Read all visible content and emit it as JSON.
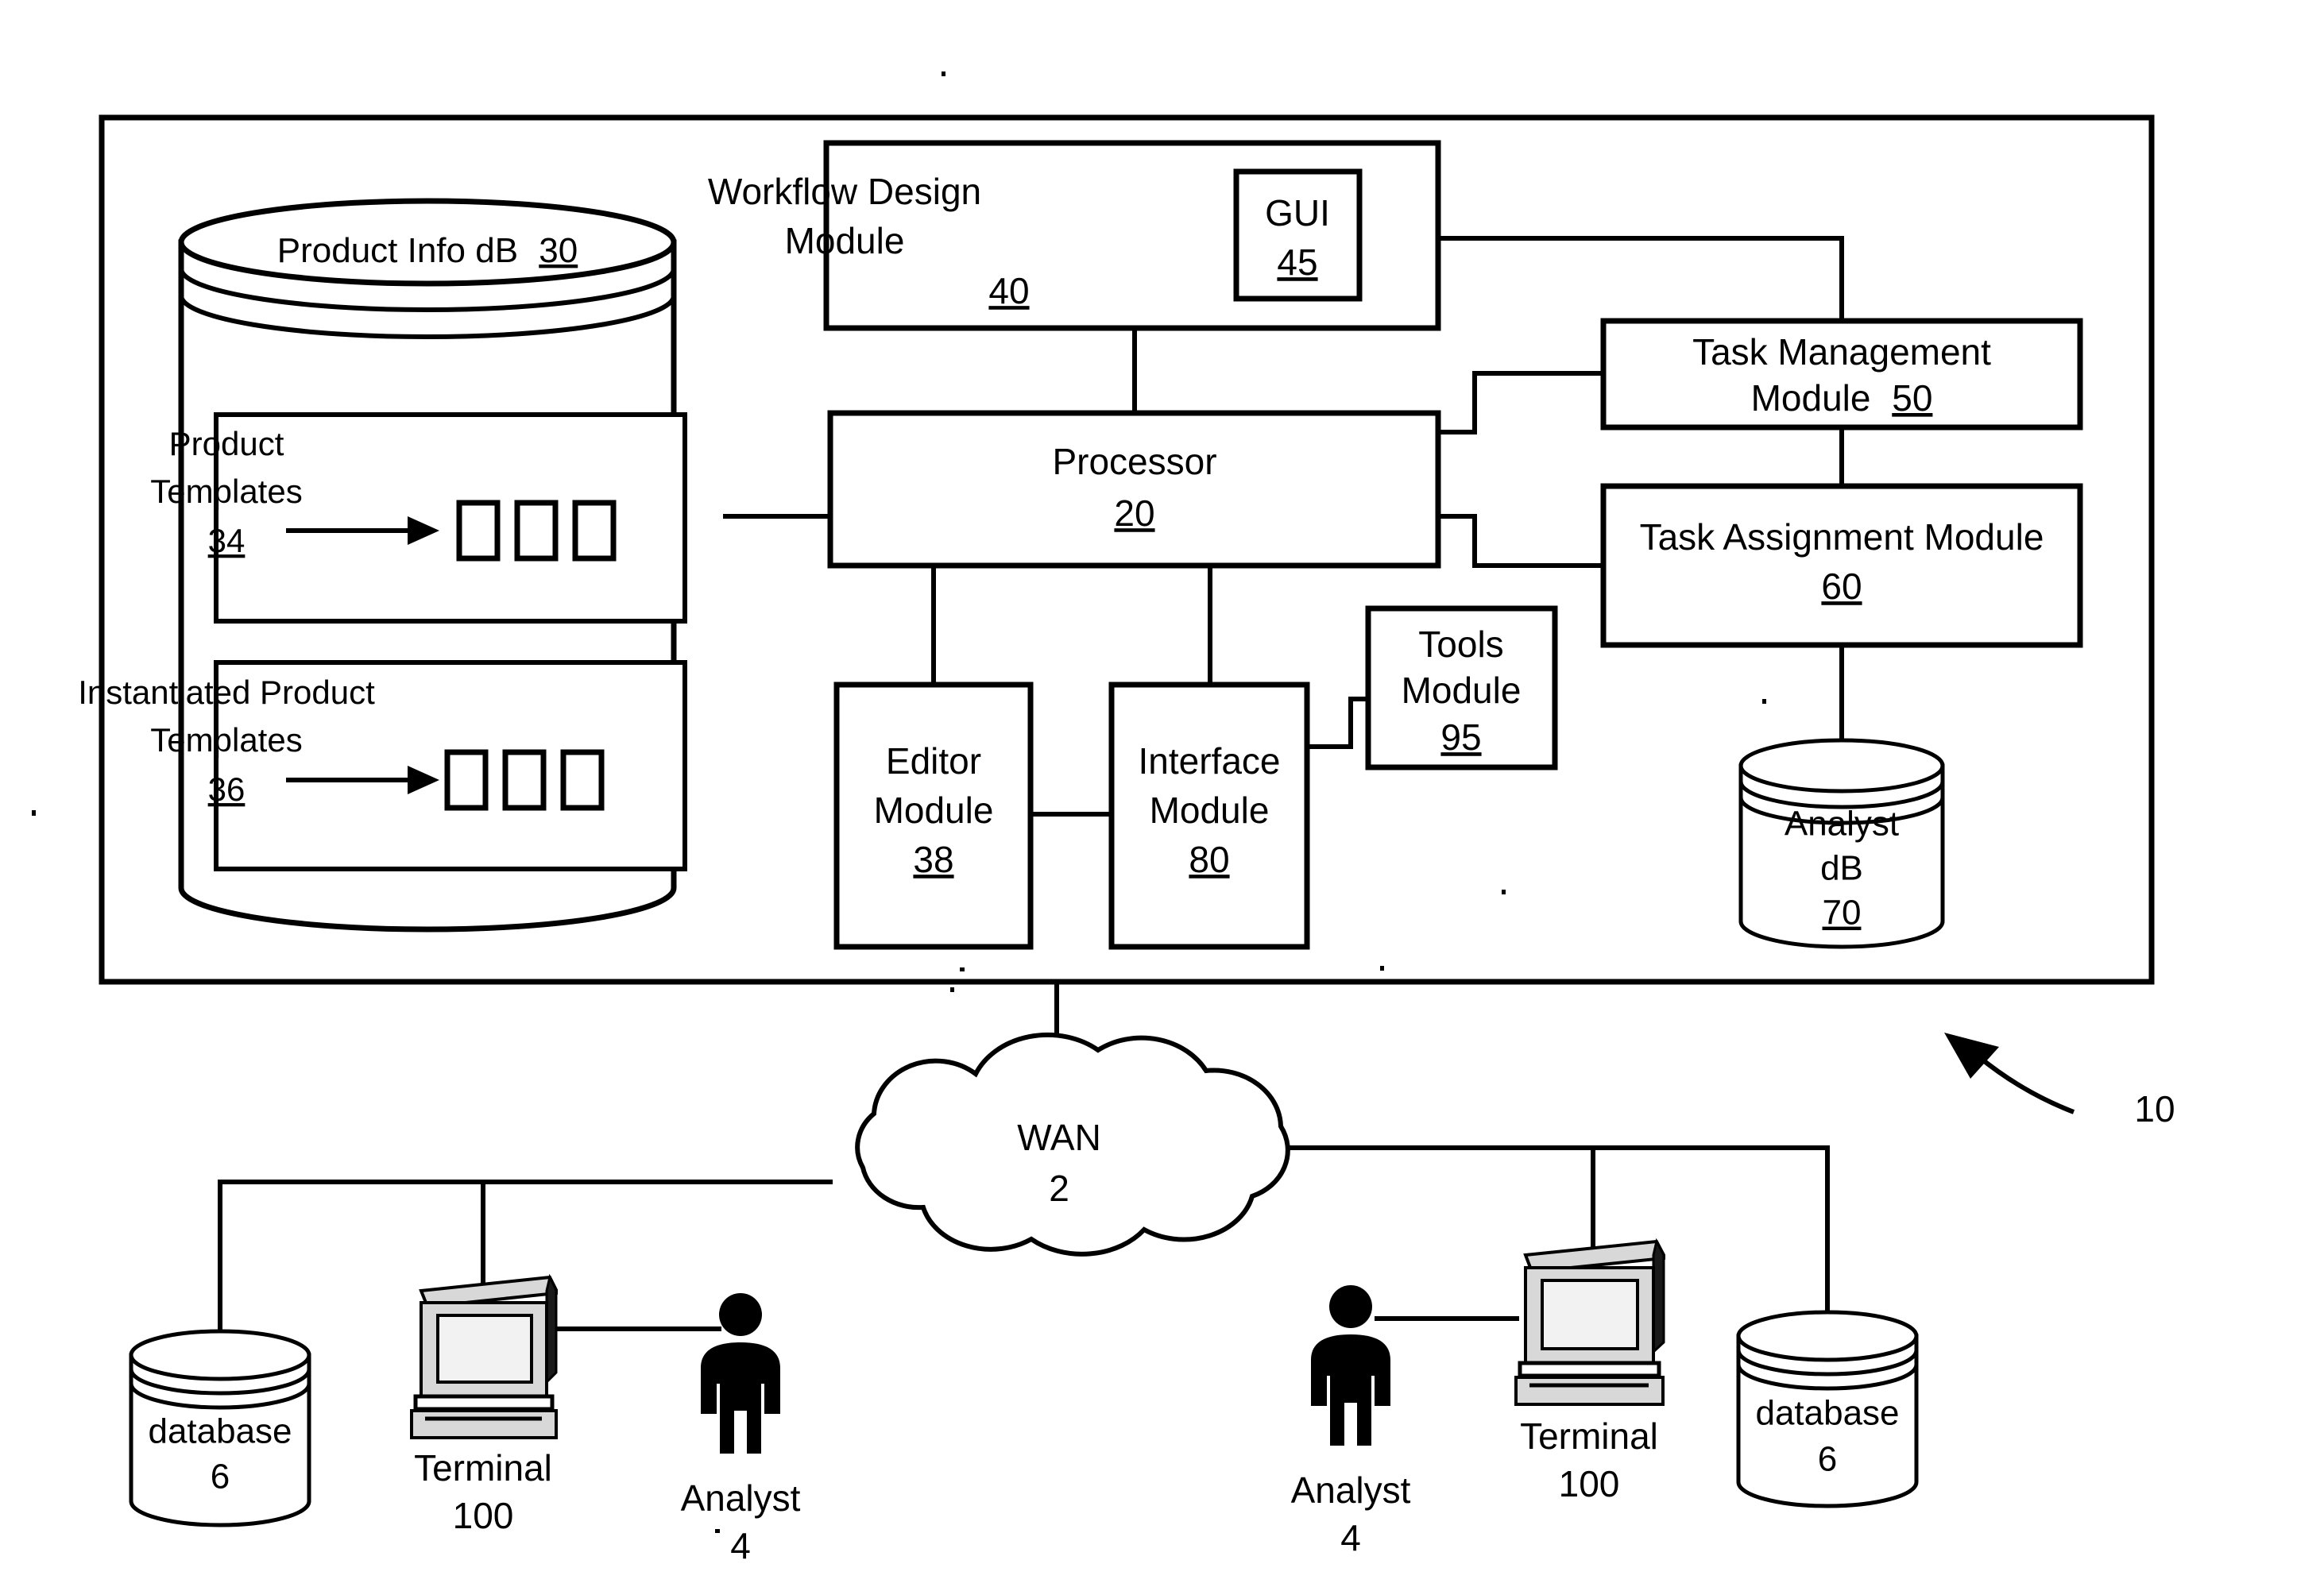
{
  "figure": {
    "reference_numeral": "10",
    "system_box": {
      "name": "system-enclosure"
    },
    "product_info_db": {
      "label": "Product Info dB",
      "numeral": "30",
      "inner_boxes": [
        {
          "label_line1": "Product",
          "label_line2": "Templates",
          "numeral": "34",
          "item_count": 3
        },
        {
          "label_line1": "Instantiated Product",
          "label_line2": "Templates",
          "numeral": "36",
          "item_count": 3
        }
      ]
    },
    "workflow_design_module": {
      "label_line1": "Workflow Design",
      "label_line2": "Module",
      "numeral": "40",
      "gui": {
        "label": "GUI",
        "numeral": "45"
      }
    },
    "processor": {
      "label": "Processor",
      "numeral": "20"
    },
    "task_management_module": {
      "label_line1": "Task Management",
      "label_line2": "Module",
      "numeral": "50"
    },
    "task_assignment_module": {
      "label_line1": "Task Assignment Module",
      "numeral": "60"
    },
    "tools_module": {
      "label_line1": "Tools",
      "label_line2": "Module",
      "numeral": "95"
    },
    "editor_module": {
      "label_line1": "Editor",
      "label_line2": "Module",
      "numeral": "38"
    },
    "interface_module": {
      "label_line1": "Interface",
      "label_line2": "Module",
      "numeral": "80"
    },
    "analyst_db": {
      "label_line1": "Analyst",
      "label_line2": "dB",
      "numeral": "70"
    },
    "wan": {
      "label": "WAN",
      "numeral": "2"
    },
    "left_group": {
      "database": {
        "label": "database",
        "numeral": "6"
      },
      "terminal": {
        "label": "Terminal",
        "numeral": "100"
      },
      "analyst": {
        "label": "Analyst",
        "numeral": "4"
      }
    },
    "right_group": {
      "analyst": {
        "label": "Analyst",
        "numeral": "4"
      },
      "terminal": {
        "label": "Terminal",
        "numeral": "100"
      },
      "database": {
        "label": "database",
        "numeral": "6"
      }
    }
  }
}
